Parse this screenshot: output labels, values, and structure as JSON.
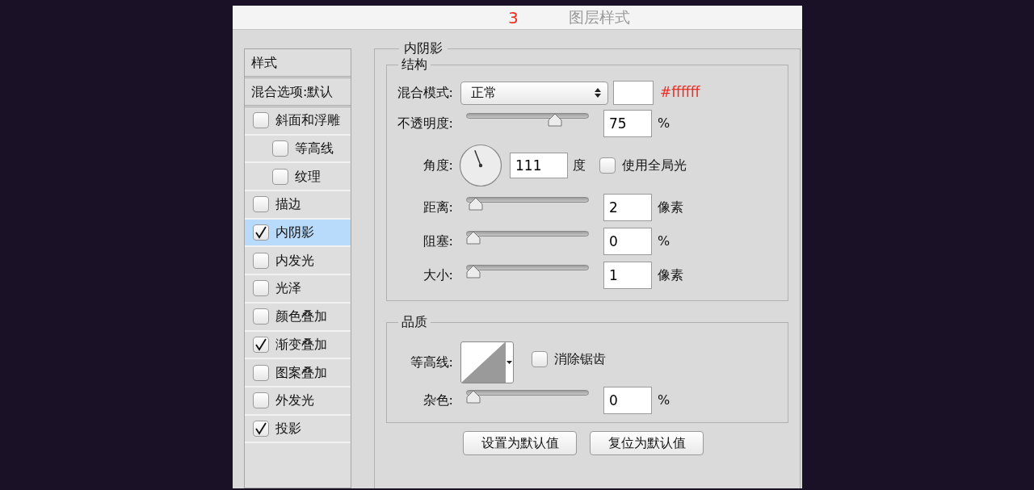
{
  "window": {
    "title": "图层样式",
    "annotation": "3"
  },
  "sidebar": {
    "items": [
      {
        "kind": "header",
        "label": "样式",
        "selected": false
      },
      {
        "kind": "header",
        "label": "混合选项:默认",
        "selected": false
      },
      {
        "kind": "checkbox",
        "label": "斜面和浮雕",
        "checked": false,
        "selected": false,
        "children": [
          {
            "kind": "checkbox",
            "label": "等高线",
            "checked": false,
            "selected": false
          },
          {
            "kind": "checkbox",
            "label": "纹理",
            "checked": false,
            "selected": false
          }
        ]
      },
      {
        "kind": "checkbox",
        "label": "描边",
        "checked": false,
        "selected": false
      },
      {
        "kind": "checkbox",
        "label": "内阴影",
        "checked": true,
        "selected": true
      },
      {
        "kind": "checkbox",
        "label": "内发光",
        "checked": false,
        "selected": false
      },
      {
        "kind": "checkbox",
        "label": "光泽",
        "checked": false,
        "selected": false
      },
      {
        "kind": "checkbox",
        "label": "颜色叠加",
        "checked": false,
        "selected": false
      },
      {
        "kind": "checkbox",
        "label": "渐变叠加",
        "checked": true,
        "selected": false
      },
      {
        "kind": "checkbox",
        "label": "图案叠加",
        "checked": false,
        "selected": false
      },
      {
        "kind": "checkbox",
        "label": "外发光",
        "checked": false,
        "selected": false
      },
      {
        "kind": "checkbox",
        "label": "投影",
        "checked": true,
        "selected": false
      }
    ]
  },
  "inner_shadow": {
    "title": "内阴影",
    "structure": {
      "title": "结构",
      "rows": [
        {
          "kind": "blend",
          "label": "混合模式:",
          "value": "正常",
          "annotation": "#ffffff"
        },
        {
          "kind": "slider",
          "label": "不透明度:",
          "value": "75",
          "unit": "%",
          "level": 0.75
        },
        {
          "kind": "angle",
          "label": "角度:",
          "value": "111",
          "unit": "度",
          "global_light": {
            "label": "使用全局光",
            "checked": false
          }
        },
        {
          "kind": "slider",
          "label": "距离:",
          "value": "2",
          "unit": "像素",
          "level": 0.02
        },
        {
          "kind": "slider",
          "label": "阻塞:",
          "value": "0",
          "unit": "%",
          "level": 0
        },
        {
          "kind": "slider",
          "label": "大小:",
          "value": "1",
          "unit": "像素",
          "level": 0
        }
      ]
    },
    "quality": {
      "title": "品质",
      "contour": {
        "label": "等高线:",
        "anti_alias": {
          "label": "消除锯齿",
          "checked": false
        }
      },
      "noise": {
        "label": "杂色:",
        "value": "0",
        "unit": "%",
        "level": 0
      }
    },
    "buttons": [
      "设置为默认值",
      "复位为默认值"
    ]
  }
}
